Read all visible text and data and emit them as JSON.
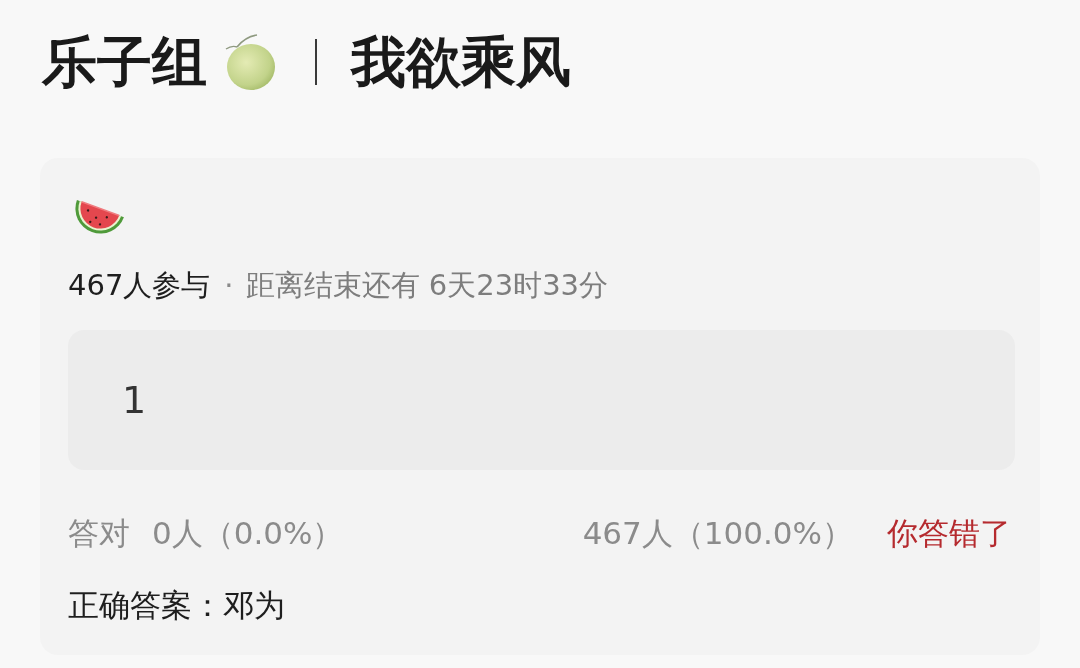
{
  "header": {
    "group_name": "乐子组",
    "title": "我欲乘风"
  },
  "poll": {
    "participants": "467人参与",
    "separator": "·",
    "deadline": "距离结束还有 6天23时33分",
    "answer": {
      "value": "1"
    },
    "result": {
      "correct_label": "答对",
      "correct_count": "0人（0.0%）",
      "chosen_count": "467人（100.0%）",
      "verdict": "你答错了",
      "is_correct": false
    },
    "correct_answer": "正确答案：邓为"
  }
}
